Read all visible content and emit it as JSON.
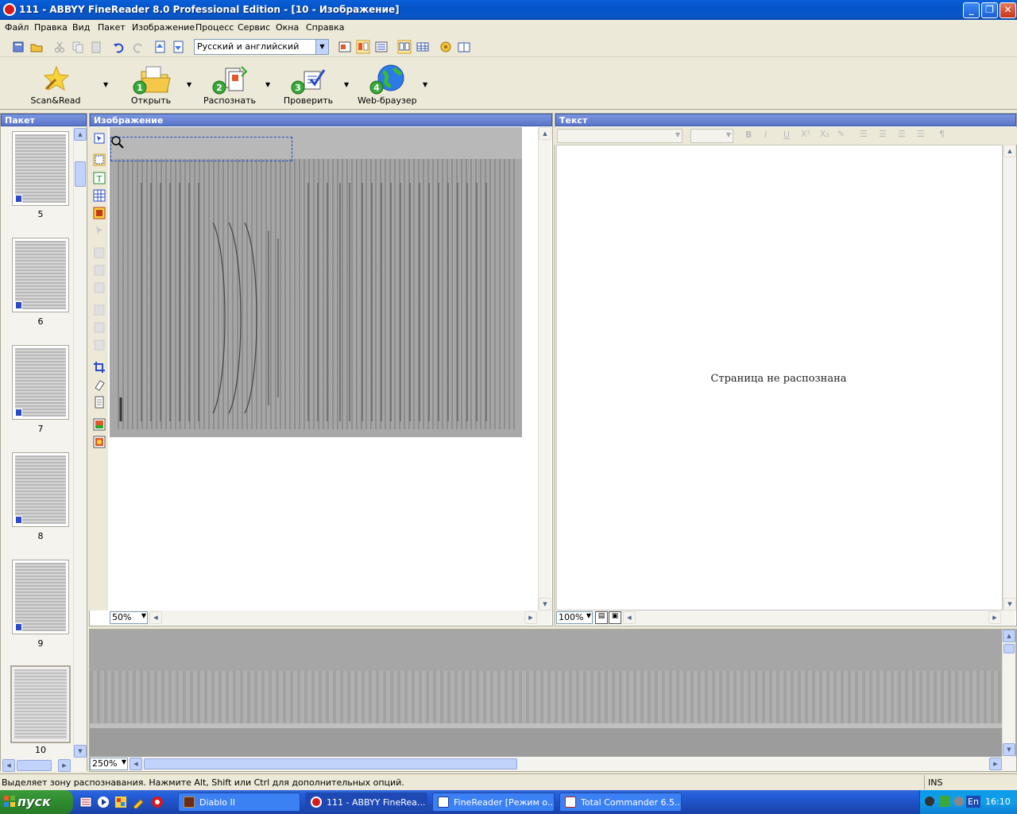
{
  "window": {
    "title": "111 - ABBYY FineReader 8.0 Professional Edition - [10 - Изображение]"
  },
  "menu": [
    "Файл",
    "Правка",
    "Вид",
    "Пакет",
    "Изображение",
    "Процесс",
    "Сервис",
    "Окна",
    "Справка"
  ],
  "toolbar": {
    "language": "Русский и английский"
  },
  "bigbuttons": [
    {
      "label": "Scan&Read",
      "icon": "wizard-star-icon"
    },
    {
      "label": "Открыть",
      "icon": "open-folder-icon",
      "step": "1"
    },
    {
      "label": "Распознать",
      "icon": "recognize-pages-icon",
      "step": "2"
    },
    {
      "label": "Проверить",
      "icon": "check-document-icon",
      "step": "3"
    },
    {
      "label": "Web-браузер",
      "icon": "globe-icon",
      "step": "4"
    }
  ],
  "panels": {
    "paket": "Пакет",
    "image": "Изображение",
    "text": "Текст"
  },
  "thumbnails": [
    "5",
    "6",
    "7",
    "8",
    "9",
    "10"
  ],
  "image_zoom": "50%",
  "text_zoom": "100%",
  "bottom_zoom": "250%",
  "text_panel": {
    "message": "Страница не распознана"
  },
  "status": {
    "message": "Выделяет зону распознавания. Нажмите Alt, Shift или Ctrl для дополнительных опций.",
    "mode": "INS"
  },
  "taskbar": {
    "start": "пуск",
    "tasks": [
      "Diablo II",
      "111 - ABBYY FineRea...",
      "FineReader [Режим о...",
      "Total Commander 6.5..."
    ],
    "lang": "En",
    "clock": "16:10"
  },
  "colors": {
    "title_blue": "#0a5fd8",
    "panel_header": "#6a86d8",
    "taskbar_blue": "#245edb",
    "start_green": "#2f8a2f"
  }
}
